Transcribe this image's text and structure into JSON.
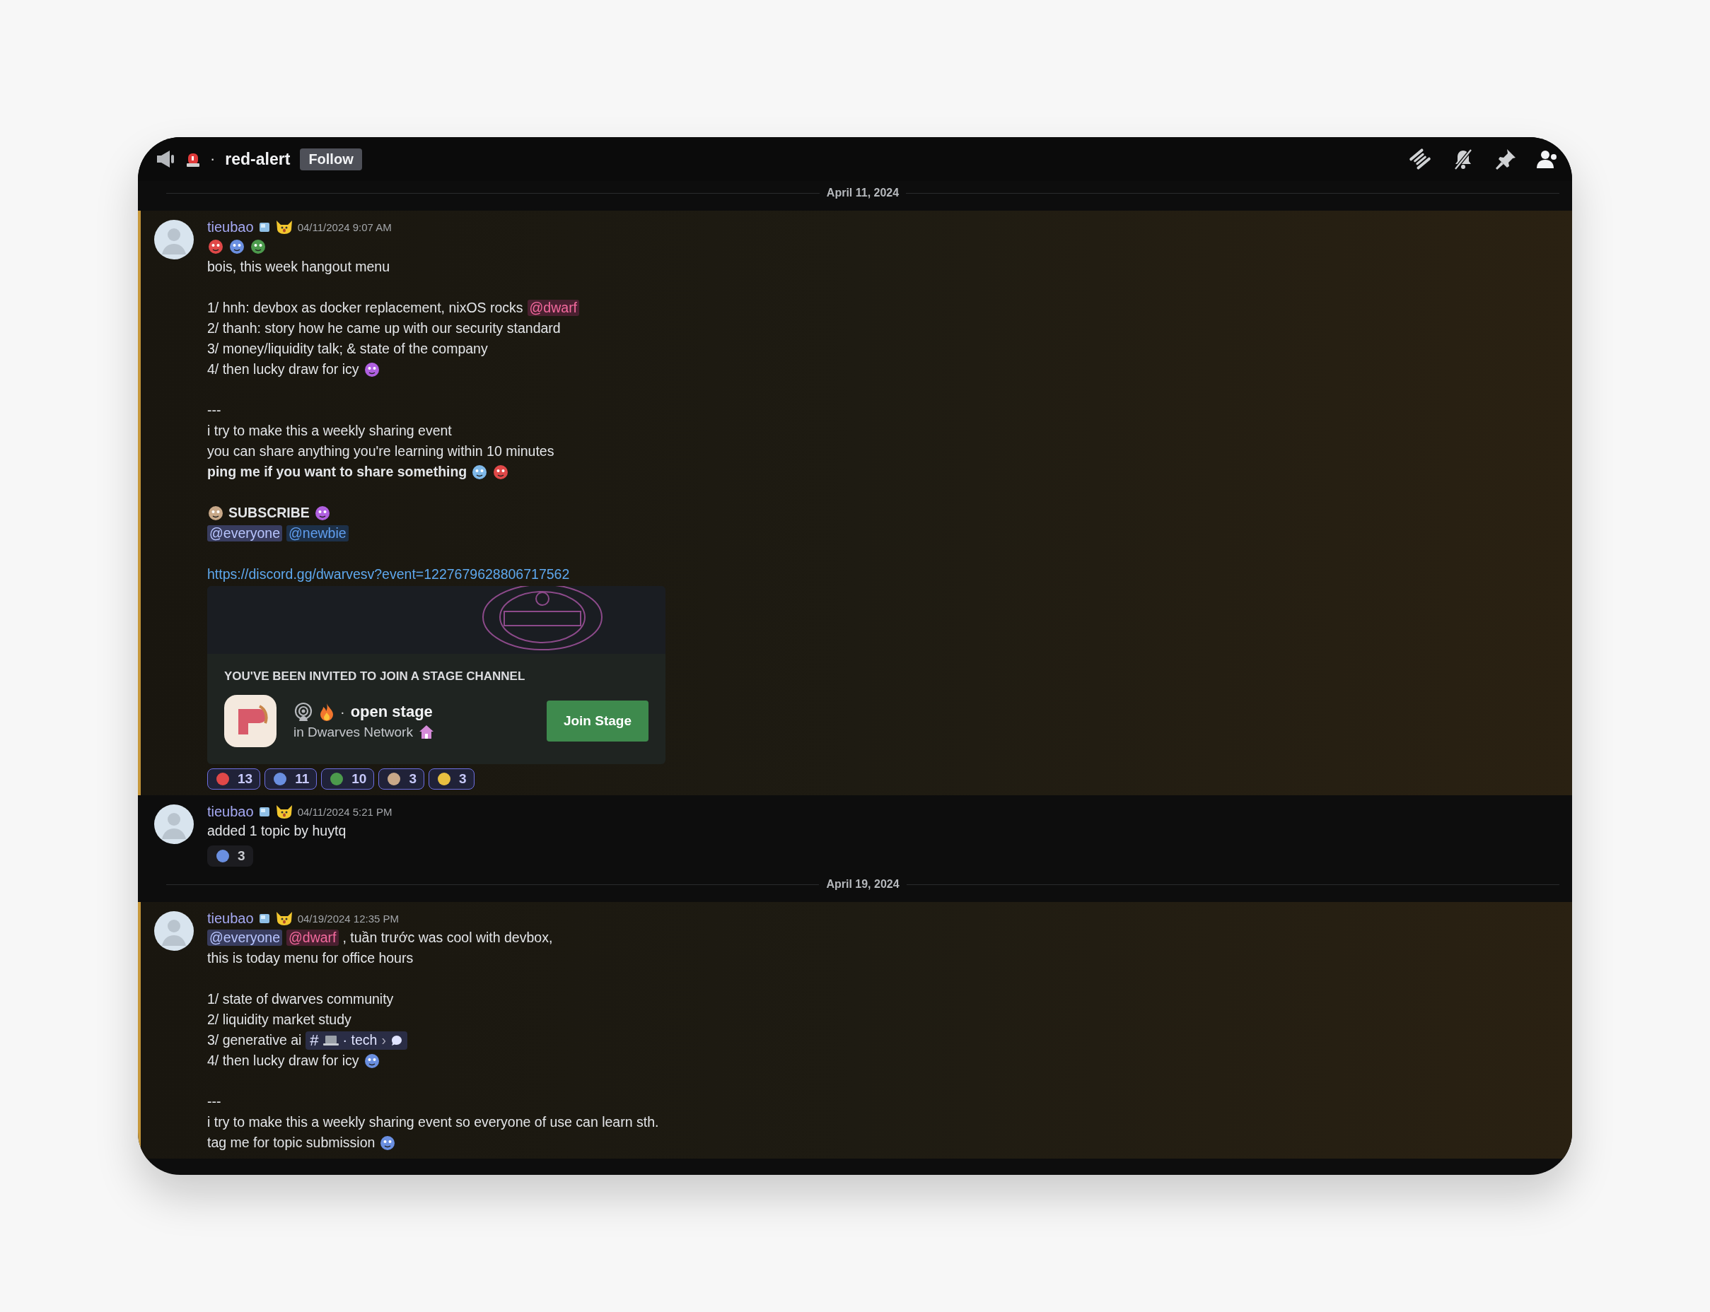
{
  "header": {
    "separator": "·",
    "channel_name": "red-alert",
    "follow_button": "Follow"
  },
  "feed": [
    {
      "kind": "divider",
      "label": "April 11, 2024"
    },
    {
      "kind": "message",
      "highlighted": true,
      "author": "tieubao",
      "timestamp": "04/11/2024 9:07 AM",
      "paragraphs": [
        {
          "lines": [
            {
              "parts": [
                {
                  "kind": "emoji"
                },
                {
                  "kind": "emoji"
                },
                {
                  "kind": "emoji"
                }
              ]
            },
            {
              "parts": [
                {
                  "kind": "text",
                  "text": "bois, this week hangout menu"
                }
              ]
            }
          ]
        },
        {
          "lines": [
            {
              "parts": [
                {
                  "kind": "text",
                  "text": "1/ hnh: devbox as docker replacement, nixOS rocks"
                },
                {
                  "kind": "mention",
                  "text": "@dwarf",
                  "color": "#4a2030"
                }
              ]
            },
            {
              "parts": [
                {
                  "kind": "text",
                  "text": "2/ thanh: story how he came up with our security standard"
                }
              ]
            },
            {
              "parts": [
                {
                  "kind": "text",
                  "text": "3/ money/liquidity talk; & state of the company"
                }
              ]
            },
            {
              "parts": [
                {
                  "kind": "text",
                  "text": "4/ then lucky draw for icy"
                },
                {
                  "kind": "emoji"
                }
              ]
            }
          ]
        },
        {
          "lines": [
            {
              "parts": [
                {
                  "kind": "text",
                  "text": "---"
                }
              ]
            },
            {
              "parts": [
                {
                  "kind": "text",
                  "text": "i try to make this a weekly sharing event"
                }
              ]
            },
            {
              "parts": [
                {
                  "kind": "text",
                  "text": "you can share anything you're learning within 10 minutes"
                }
              ]
            },
            {
              "parts": [
                {
                  "kind": "bold",
                  "text": "ping me if you want to share something"
                },
                {
                  "kind": "emoji"
                },
                {
                  "kind": "emoji"
                }
              ]
            }
          ]
        },
        {
          "lines": [
            {
              "parts": [
                {
                  "kind": "emoji"
                },
                {
                  "kind": "bold",
                  "text": "SUBSCRIBE"
                },
                {
                  "kind": "emoji"
                }
              ]
            },
            {
              "parts": [
                {
                  "kind": "mention",
                  "text": "@everyone",
                  "color": "#383c5e"
                },
                {
                  "kind": "mention",
                  "text": "@newbie",
                  "color": "#1d3048"
                }
              ]
            }
          ]
        },
        {
          "lines": [
            {
              "parts": [
                {
                  "kind": "link",
                  "text": "https://discord.gg/dwarvesv?event=1227679628806717562"
                }
              ]
            }
          ]
        }
      ],
      "invite": {
        "heading": "YOU'VE BEEN INVITED TO JOIN A STAGE CHANNEL",
        "separator": "·",
        "channel": "open stage",
        "server": "in Dwarves Network",
        "button": "Join Stage"
      },
      "reactions": [
        {
          "count": "13",
          "selected": true
        },
        {
          "count": "11",
          "selected": true
        },
        {
          "count": "10",
          "selected": true
        },
        {
          "count": "3",
          "selected": true
        },
        {
          "count": "3",
          "selected": true
        }
      ]
    },
    {
      "kind": "message",
      "highlighted": false,
      "author": "tieubao",
      "timestamp": "04/11/2024 5:21 PM",
      "paragraphs": [
        {
          "lines": [
            {
              "parts": [
                {
                  "kind": "text",
                  "text": "added 1 topic by huytq"
                }
              ]
            }
          ]
        }
      ],
      "reactions": [
        {
          "count": "3",
          "selected": false
        }
      ]
    },
    {
      "kind": "divider",
      "label": "April 19, 2024"
    },
    {
      "kind": "message",
      "highlighted": true,
      "author": "tieubao",
      "timestamp": "04/19/2024 12:35 PM",
      "paragraphs": [
        {
          "lines": [
            {
              "parts": [
                {
                  "kind": "mention",
                  "text": "@everyone",
                  "color": "#383c5e"
                },
                {
                  "kind": "mention",
                  "text": "@dwarf",
                  "color": "#4a2030"
                },
                {
                  "kind": "text",
                  "text": ", tuần trước was cool with devbox,"
                }
              ]
            },
            {
              "parts": [
                {
                  "kind": "text",
                  "text": "this is today menu for office hours"
                }
              ]
            }
          ]
        },
        {
          "lines": [
            {
              "parts": [
                {
                  "kind": "text",
                  "text": "1/ state of dwarves community"
                }
              ]
            },
            {
              "parts": [
                {
                  "kind": "text",
                  "text": "2/ liquidity market study"
                }
              ]
            },
            {
              "parts": [
                {
                  "kind": "text",
                  "text": "3/ generative ai"
                },
                {
                  "kind": "channel",
                  "hash": "#",
                  "label": "· tech",
                  "arrow": "›"
                }
              ]
            },
            {
              "parts": [
                {
                  "kind": "text",
                  "text": "4/ then lucky draw for icy"
                },
                {
                  "kind": "emoji"
                }
              ]
            }
          ]
        },
        {
          "lines": [
            {
              "parts": [
                {
                  "kind": "text",
                  "text": "---"
                }
              ]
            },
            {
              "parts": [
                {
                  "kind": "text",
                  "text": "i try to make this a weekly sharing event so everyone of use can learn sth."
                }
              ]
            },
            {
              "parts": [
                {
                  "kind": "text",
                  "text": "tag me for topic submission"
                },
                {
                  "kind": "emoji"
                }
              ]
            }
          ]
        }
      ]
    }
  ]
}
